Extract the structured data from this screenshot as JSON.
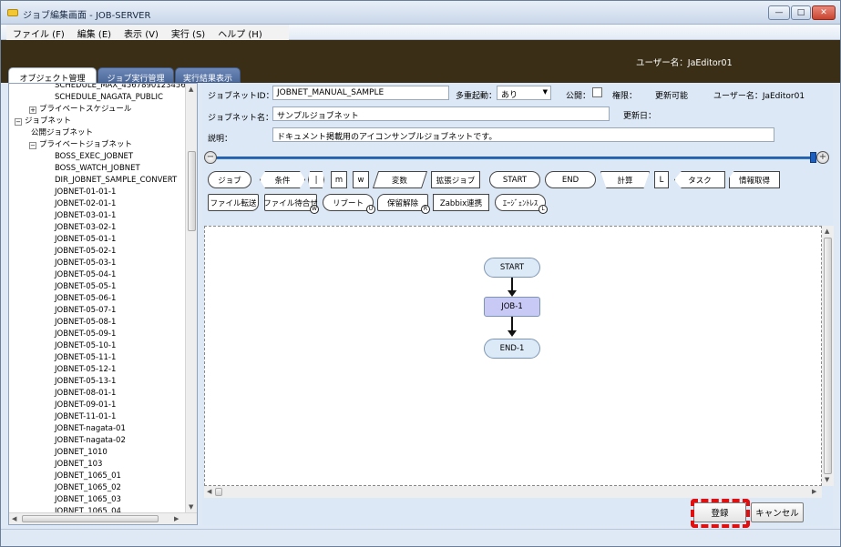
{
  "window": {
    "title": "ジョブ編集画面 - JOB-SERVER"
  },
  "menu": [
    "ファイル (F)",
    "編集 (E)",
    "表示 (V)",
    "実行 (S)",
    "ヘルプ (H)"
  ],
  "header": {
    "user_label": "ユーザー名：JaEditor01"
  },
  "tabs": [
    "オブジェクト管理",
    "ジョブ実行管理",
    "実行結果表示"
  ],
  "tree": [
    {
      "label": "SCHEDULE_MAX_4567890123456",
      "indent": 3,
      "expander": ""
    },
    {
      "label": "SCHEDULE_NAGATA_PUBLIC",
      "indent": 3,
      "expander": ""
    },
    {
      "label": "プライベートスケジュール",
      "indent": 2,
      "expander": "+"
    },
    {
      "label": "ジョブネット",
      "indent": 1,
      "expander": "-"
    },
    {
      "label": "公開ジョブネット",
      "indent": 2,
      "expander": ""
    },
    {
      "label": "プライベートジョブネット",
      "indent": 2,
      "expander": "-"
    },
    {
      "label": "BOSS_EXEC_JOBNET",
      "indent": 3,
      "expander": ""
    },
    {
      "label": "BOSS_WATCH_JOBNET",
      "indent": 3,
      "expander": ""
    },
    {
      "label": "DIR_JOBNET_SAMPLE_CONVERT",
      "indent": 3,
      "expander": ""
    },
    {
      "label": "JOBNET-01-01-1",
      "indent": 3,
      "expander": ""
    },
    {
      "label": "JOBNET-02-01-1",
      "indent": 3,
      "expander": ""
    },
    {
      "label": "JOBNET-03-01-1",
      "indent": 3,
      "expander": ""
    },
    {
      "label": "JOBNET-03-02-1",
      "indent": 3,
      "expander": ""
    },
    {
      "label": "JOBNET-05-01-1",
      "indent": 3,
      "expander": ""
    },
    {
      "label": "JOBNET-05-02-1",
      "indent": 3,
      "expander": ""
    },
    {
      "label": "JOBNET-05-03-1",
      "indent": 3,
      "expander": ""
    },
    {
      "label": "JOBNET-05-04-1",
      "indent": 3,
      "expander": ""
    },
    {
      "label": "JOBNET-05-05-1",
      "indent": 3,
      "expander": ""
    },
    {
      "label": "JOBNET-05-06-1",
      "indent": 3,
      "expander": ""
    },
    {
      "label": "JOBNET-05-07-1",
      "indent": 3,
      "expander": ""
    },
    {
      "label": "JOBNET-05-08-1",
      "indent": 3,
      "expander": ""
    },
    {
      "label": "JOBNET-05-09-1",
      "indent": 3,
      "expander": ""
    },
    {
      "label": "JOBNET-05-10-1",
      "indent": 3,
      "expander": ""
    },
    {
      "label": "JOBNET-05-11-1",
      "indent": 3,
      "expander": ""
    },
    {
      "label": "JOBNET-05-12-1",
      "indent": 3,
      "expander": ""
    },
    {
      "label": "JOBNET-05-13-1",
      "indent": 3,
      "expander": ""
    },
    {
      "label": "JOBNET-08-01-1",
      "indent": 3,
      "expander": ""
    },
    {
      "label": "JOBNET-09-01-1",
      "indent": 3,
      "expander": ""
    },
    {
      "label": "JOBNET-11-01-1",
      "indent": 3,
      "expander": ""
    },
    {
      "label": "JOBNET-nagata-01",
      "indent": 3,
      "expander": ""
    },
    {
      "label": "JOBNET-nagata-02",
      "indent": 3,
      "expander": ""
    },
    {
      "label": "JOBNET_1010",
      "indent": 3,
      "expander": ""
    },
    {
      "label": "JOBNET_103",
      "indent": 3,
      "expander": ""
    },
    {
      "label": "JOBNET_1065_01",
      "indent": 3,
      "expander": ""
    },
    {
      "label": "JOBNET_1065_02",
      "indent": 3,
      "expander": ""
    },
    {
      "label": "JOBNET_1065_03",
      "indent": 3,
      "expander": ""
    },
    {
      "label": "JOBNET_1065_04",
      "indent": 3,
      "expander": ""
    }
  ],
  "form": {
    "jobnet_id_label": "ジョブネットID：",
    "jobnet_id_value": "JOBNET_MANUAL_SAMPLE",
    "multi_start_label": "多重起動：",
    "multi_start_value": "あり",
    "public_label": "公開：",
    "permission_label": "権限：",
    "permission_value": "更新可能",
    "user_label": "ユーザー名：JaEditor01",
    "jobnet_name_label": "ジョブネット名：",
    "jobnet_name_value": "サンプルジョブネット",
    "updated_label": "更新日：",
    "description_label": "説明：",
    "description_value": "ドキュメント掲載用のアイコンサンプルジョブネットです。"
  },
  "toolbox": {
    "row1": [
      "ジョブ",
      "条件",
      "|",
      "m",
      "w",
      "変数",
      "拡張ジョブ",
      "START",
      "END",
      "計算",
      "L",
      "タスク",
      "情報取得"
    ],
    "row2": [
      "ファイル転送",
      "ファイル待合せ",
      "リブート",
      "保留解除",
      "Zabbix連携",
      "ｴｰｼﾞｪﾝﾄﾚｽ"
    ],
    "row2_badges": [
      "",
      "W",
      "U",
      "R",
      "",
      "L"
    ]
  },
  "flow": {
    "nodes": [
      {
        "label": "START",
        "kind": "start"
      },
      {
        "label": "JOB-1",
        "kind": "job"
      },
      {
        "label": "END-1",
        "kind": "end"
      }
    ]
  },
  "buttons": {
    "save": "登録",
    "cancel": "キャンセル"
  },
  "colors": {
    "header_bg": "#3a2f16",
    "start_node": "#dceaf8",
    "job_node": "#c9c9f5",
    "highlight": "#e01010"
  }
}
